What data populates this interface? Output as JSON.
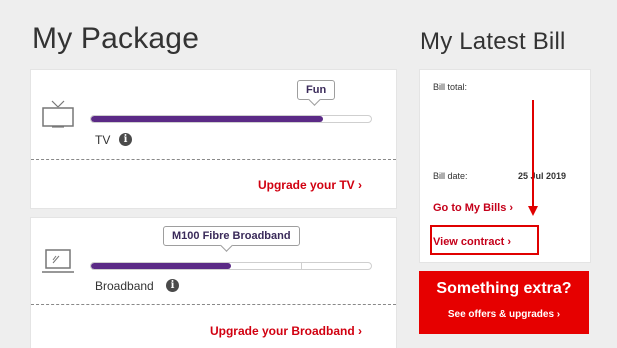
{
  "package": {
    "title": "My Package",
    "tv": {
      "tag": "Fun",
      "label": "TV",
      "usage": 0.83,
      "upgrade_link": "Upgrade your TV ›"
    },
    "broadband": {
      "tag": "M100 Fibre Broadband",
      "label": "Broadband",
      "usage": 0.5,
      "upgrade_link": "Upgrade your Broadband ›"
    }
  },
  "bill": {
    "title": "My Latest Bill",
    "total_label": "Bill total:",
    "date_label": "Bill date:",
    "date_value": "25 Jul 2019",
    "go_to_bills": "Go to My Bills ›",
    "view_contract": "View contract ›"
  },
  "promo": {
    "title": "Something extra?",
    "link": "See offers & upgrades ›"
  },
  "colors": {
    "accent": "#d10010",
    "bar": "#5b2a86",
    "promo_bg": "#e60000"
  },
  "icons": {
    "info": "info-icon",
    "tv": "tv-icon",
    "laptop": "laptop-icon"
  }
}
